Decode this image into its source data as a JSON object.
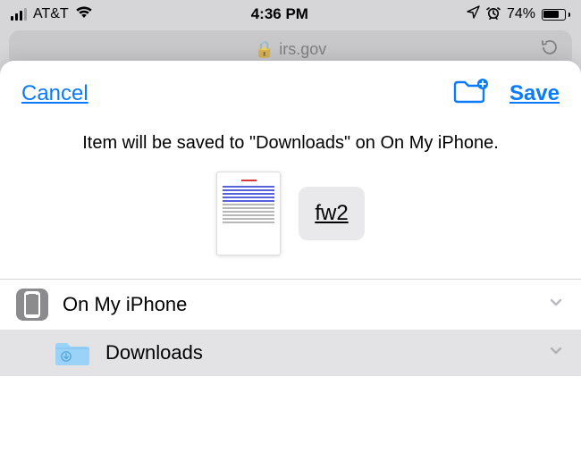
{
  "status": {
    "carrier": "AT&T",
    "time": "4:36 PM",
    "battery_pct": "74%",
    "battery_fill_pct": 74
  },
  "safari": {
    "address_hint": "irs.gov",
    "lock_prefix": "🔒"
  },
  "sheet": {
    "cancel": "Cancel",
    "save": "Save",
    "message": "Item will be saved to \"Downloads\" on On My iPhone.",
    "filename": "fw2"
  },
  "locations": {
    "root": "On My iPhone",
    "child": "Downloads"
  },
  "colors": {
    "accent": "#0a7aff"
  }
}
